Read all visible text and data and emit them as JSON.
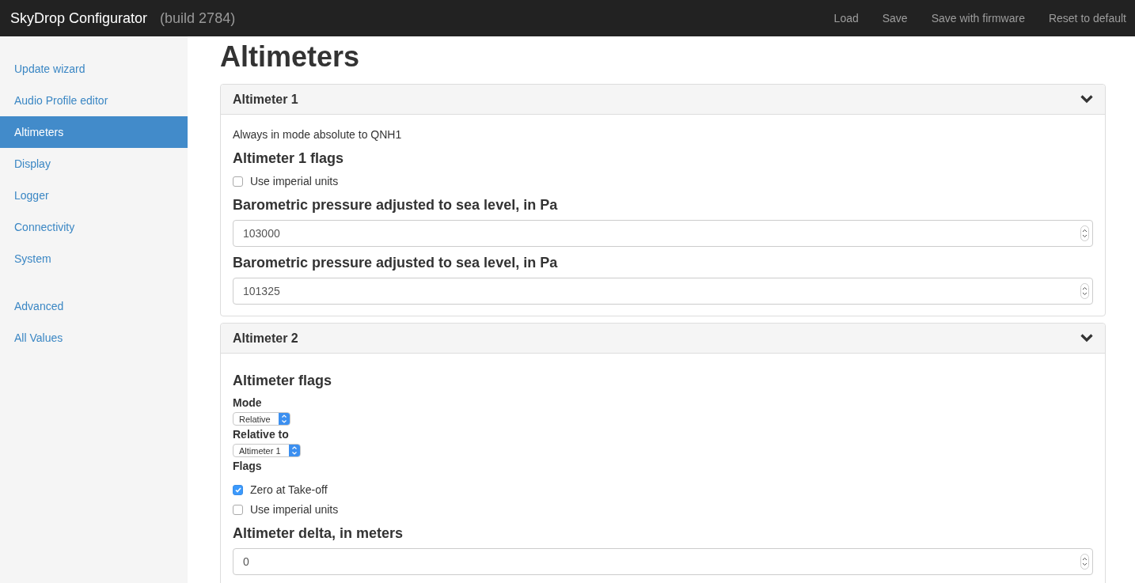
{
  "navbar": {
    "brand": "SkyDrop Configurator",
    "build": "(build 2784)",
    "links": [
      "Load",
      "Save",
      "Save with firmware",
      "Reset to default"
    ]
  },
  "sidebar": {
    "groups": [
      [
        {
          "label": "Update wizard",
          "selected": false
        },
        {
          "label": "Audio Profile editor",
          "selected": false
        },
        {
          "label": "Altimeters",
          "selected": true
        },
        {
          "label": "Display",
          "selected": false
        },
        {
          "label": "Logger",
          "selected": false
        },
        {
          "label": "Connectivity",
          "selected": false
        },
        {
          "label": "System",
          "selected": false
        }
      ],
      [
        {
          "label": "Advanced",
          "selected": false
        },
        {
          "label": "All Values",
          "selected": false
        }
      ]
    ]
  },
  "page_title": "Altimeters",
  "panels": [
    {
      "title": "Altimeter 1",
      "expanded": true,
      "content": [
        {
          "kind": "note",
          "text": "Always in mode absolute to QNH1"
        },
        {
          "kind": "heading",
          "text": "Altimeter 1 flags"
        },
        {
          "kind": "checkbox",
          "label": "Use imperial units",
          "checked": false
        },
        {
          "kind": "heading",
          "text": "Barometric pressure adjusted to sea level, in Pa"
        },
        {
          "kind": "number",
          "value": "103000"
        },
        {
          "kind": "heading",
          "text": "Barometric pressure adjusted to sea level, in Pa"
        },
        {
          "kind": "number",
          "value": "101325"
        }
      ]
    },
    {
      "title": "Altimeter 2",
      "expanded": true,
      "content": [
        {
          "kind": "heading",
          "text": "Altimeter flags"
        },
        {
          "kind": "label",
          "text": "Mode"
        },
        {
          "kind": "select",
          "value": "Relative"
        },
        {
          "kind": "label",
          "text": "Relative to"
        },
        {
          "kind": "select",
          "value": "Altimeter 1"
        },
        {
          "kind": "label",
          "text": "Flags"
        },
        {
          "kind": "checkbox",
          "label": "Zero at Take-off",
          "checked": true
        },
        {
          "kind": "checkbox",
          "label": "Use imperial units",
          "checked": false
        },
        {
          "kind": "heading",
          "text": "Altimeter delta, in meters"
        },
        {
          "kind": "number",
          "value": "0"
        }
      ]
    }
  ]
}
